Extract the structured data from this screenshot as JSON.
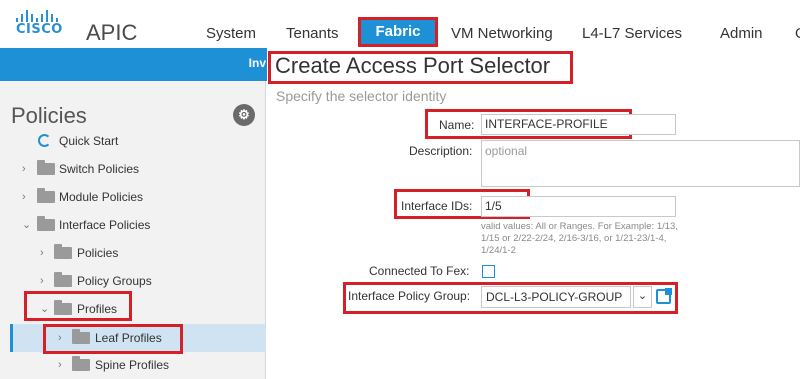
{
  "app": {
    "logo_text": "CISCO",
    "title": "APIC"
  },
  "topnav": {
    "tabs": [
      "System",
      "Tenants",
      "Fabric",
      "VM Networking",
      "L4-L7 Services",
      "Admin",
      "O"
    ],
    "active": "Fabric"
  },
  "subbar": {
    "label": "Inv"
  },
  "sidebar": {
    "title": "Policies",
    "gear": "⚙",
    "items": [
      {
        "label": "Quick Start"
      },
      {
        "label": "Switch Policies"
      },
      {
        "label": "Module Policies"
      },
      {
        "label": "Interface Policies"
      },
      {
        "label": "Policies"
      },
      {
        "label": "Policy Groups"
      },
      {
        "label": "Profiles"
      },
      {
        "label": "Leaf Profiles"
      },
      {
        "label": "Spine Profiles"
      }
    ]
  },
  "dialog": {
    "title": "Create Access Port Selector",
    "subtitle": "Specify the selector identity",
    "name_label": "Name:",
    "name_value": "INTERFACE-PROFILE",
    "description_label": "Description:",
    "description_placeholder": "optional",
    "interface_ids_label": "Interface IDs:",
    "interface_ids_value": "1/5",
    "interface_ids_hint": "valid values: All or Ranges. For Example: 1/13, 1/15 or 2/22-2/24, 2/16-3/16, or 1/21-23/1-4, 1/24/1-2",
    "connected_to_fex_label": "Connected To Fex:",
    "connected_to_fex_checked": false,
    "policy_group_label": "Interface Policy Group:",
    "policy_group_value": "DCL-L3-POLICY-GROUP"
  },
  "colors": {
    "accent": "#1e90d6",
    "highlight": "#d62027",
    "selected_bg": "#cfe3f2"
  }
}
